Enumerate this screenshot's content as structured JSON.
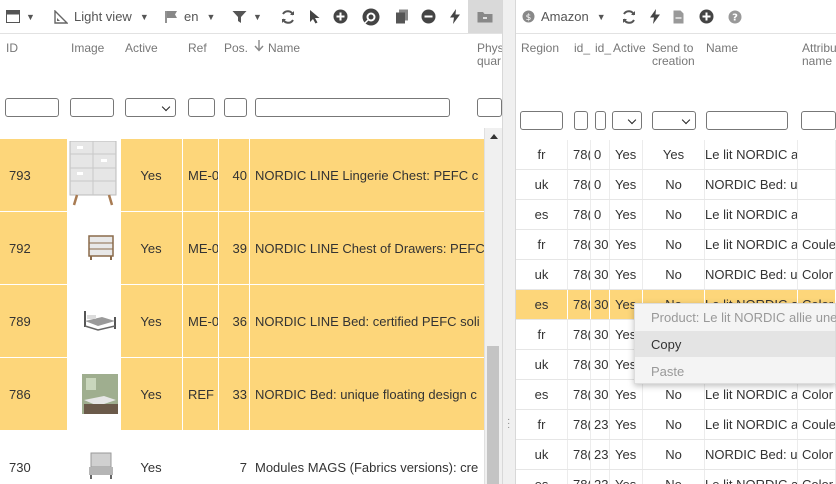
{
  "left_toolbar": {
    "view_label": "Light view",
    "lang_label": "en"
  },
  "left_headers": {
    "id": "ID",
    "image": "Image",
    "active": "Active",
    "ref": "Ref",
    "pos": "Pos.",
    "name": "Name",
    "phys_line1": "Phys",
    "phys_line2": "quar"
  },
  "left_rows": [
    {
      "id": "793",
      "active": "Yes",
      "ref": "ME-0",
      "pos": "40",
      "name": "NORDIC LINE Lingerie Chest: PEFC c",
      "highlight": true
    },
    {
      "id": "792",
      "active": "Yes",
      "ref": "ME-0",
      "pos": "39",
      "name": "NORDIC LINE Chest of Drawers: PEFC",
      "highlight": true
    },
    {
      "id": "789",
      "active": "Yes",
      "ref": "ME-0",
      "pos": "36",
      "name": "NORDIC LINE Bed: certified PEFC soli",
      "highlight": true
    },
    {
      "id": "786",
      "active": "Yes",
      "ref": "REF I",
      "pos": "33",
      "name": "NORDIC Bed: unique floating design c",
      "highlight": true
    },
    {
      "id": "730",
      "active": "Yes",
      "ref": "",
      "pos": "7",
      "name": "Modules MAGS (Fabrics versions): cre",
      "highlight": false
    }
  ],
  "right_toolbar": {
    "marketplace_label": "Amazon"
  },
  "right_headers": {
    "region": "Region",
    "id1": "id_",
    "id2": "id_",
    "active": "Active",
    "send_line1": "Send to",
    "send_line2": "creation",
    "name": "Name",
    "attr_line1": "Attribu",
    "attr_line2": "name"
  },
  "right_rows": [
    {
      "region": "fr",
      "id1": "78(",
      "id2": "0",
      "active": "Yes",
      "send": "Yes",
      "name": "Le lit NORDIC al",
      "attr": "",
      "highlight": false
    },
    {
      "region": "uk",
      "id1": "78(",
      "id2": "0",
      "active": "Yes",
      "send": "No",
      "name": "NORDIC Bed: ur",
      "attr": "",
      "highlight": false
    },
    {
      "region": "es",
      "id1": "78(",
      "id2": "0",
      "active": "Yes",
      "send": "No",
      "name": "Le lit NORDIC al",
      "attr": "",
      "highlight": false
    },
    {
      "region": "fr",
      "id1": "78(",
      "id2": "30",
      "active": "Yes",
      "send": "No",
      "name": "Le lit NORDIC al",
      "attr": "Couleu",
      "highlight": false
    },
    {
      "region": "uk",
      "id1": "78(",
      "id2": "30",
      "active": "Yes",
      "send": "No",
      "name": "NORDIC Bed: ur",
      "attr": "Color -",
      "highlight": false
    },
    {
      "region": "es",
      "id1": "78(",
      "id2": "30",
      "active": "Yes",
      "send": "No",
      "name": "Le lit NORDIC al",
      "attr": "Color -",
      "highlight": true
    },
    {
      "region": "fr",
      "id1": "78(",
      "id2": "30",
      "active": "Yes",
      "send": "No",
      "name": "Le lit NORDIC al",
      "attr": "",
      "highlight": false
    },
    {
      "region": "uk",
      "id1": "78(",
      "id2": "30",
      "active": "Yes",
      "send": "No",
      "name": "NORDIC Bed: ur",
      "attr": "",
      "highlight": false
    },
    {
      "region": "es",
      "id1": "78(",
      "id2": "30",
      "active": "Yes",
      "send": "No",
      "name": "Le lit NORDIC al",
      "attr": "Color -",
      "highlight": false
    },
    {
      "region": "fr",
      "id1": "78(",
      "id2": "23",
      "active": "Yes",
      "send": "No",
      "name": "Le lit NORDIC al",
      "attr": "Couleu",
      "highlight": false
    },
    {
      "region": "uk",
      "id1": "78(",
      "id2": "23",
      "active": "Yes",
      "send": "No",
      "name": "NORDIC Bed: ur",
      "attr": "Color -",
      "highlight": false
    },
    {
      "region": "es",
      "id1": "78(",
      "id2": "23",
      "active": "Yes",
      "send": "No",
      "name": "Le lit NORDIC al",
      "attr": "Color -",
      "highlight": false
    }
  ],
  "context_menu": {
    "title": "Product: Le lit NORDIC allie une l",
    "copy": "Copy",
    "paste": "Paste"
  },
  "colors": {
    "row_highlight": "#fdd67a",
    "icon_gray": "#555555"
  }
}
